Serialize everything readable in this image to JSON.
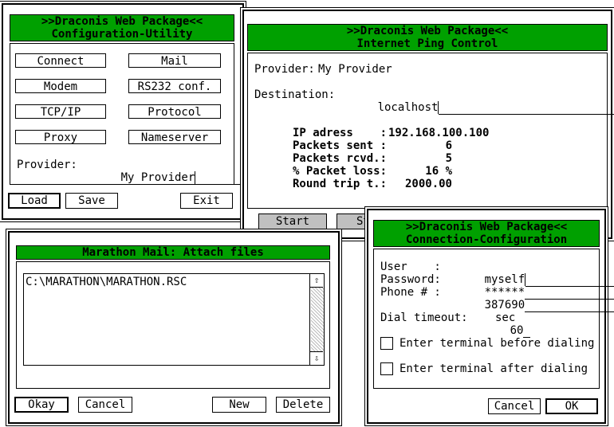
{
  "config_window": {
    "title_line1": ">>Draconis Web Package<<",
    "title_line2": "Configuration-Utility",
    "buttons": {
      "connect": "Connect",
      "mail": "Mail",
      "modem": "Modem",
      "rs232": "RS232 conf.",
      "tcpip": "TCP/IP",
      "protocol": "Protocol",
      "proxy": "Proxy",
      "nameserver": "Nameserver"
    },
    "provider_label": "Provider:",
    "provider_value": "My Provider",
    "load": "Load",
    "save": "Save",
    "exit": "Exit"
  },
  "ping_window": {
    "title_line1": ">>Draconis Web Package<<",
    "title_line2": "Internet Ping Control",
    "provider_label": "Provider:",
    "provider_value": "My Provider",
    "destination_label": "Destination:",
    "destination_value": "localhost",
    "stats": {
      "ip_label": "IP adress    :",
      "ip_value": "192.168.100.100",
      "sent_label": "Packets sent :",
      "sent_value": "6",
      "rcvd_label": "Packets rcvd.:",
      "rcvd_value": "5",
      "loss_label": "% Packet loss:",
      "loss_value": "16 %",
      "rtt_label": "Round trip t.:",
      "rtt_value": "2000.00"
    },
    "start": "Start",
    "stop": "St"
  },
  "mail_window": {
    "title": "Marathon Mail: Attach files",
    "files": [
      "C:\\MARATHON\\MARATHON.RSC"
    ],
    "okay": "Okay",
    "cancel": "Cancel",
    "new": "New",
    "delete": "Delete",
    "scroll_up": "⇧",
    "scroll_down": "⇩"
  },
  "conn_window": {
    "title_line1": ">>Draconis Web Package<<",
    "title_line2": "Connection-Configuration",
    "user_label": "User    :",
    "user_value": "myself",
    "password_label": "Password:",
    "password_value": "******",
    "phone_label": "Phone # :",
    "phone_value": "387690",
    "dial_label": "Dial timeout:",
    "dial_value": "60",
    "dial_unit": "sec",
    "enter_before": "Enter terminal before dialing",
    "enter_after": "Enter terminal after dialing",
    "cancel": "Cancel",
    "ok": "OK"
  }
}
